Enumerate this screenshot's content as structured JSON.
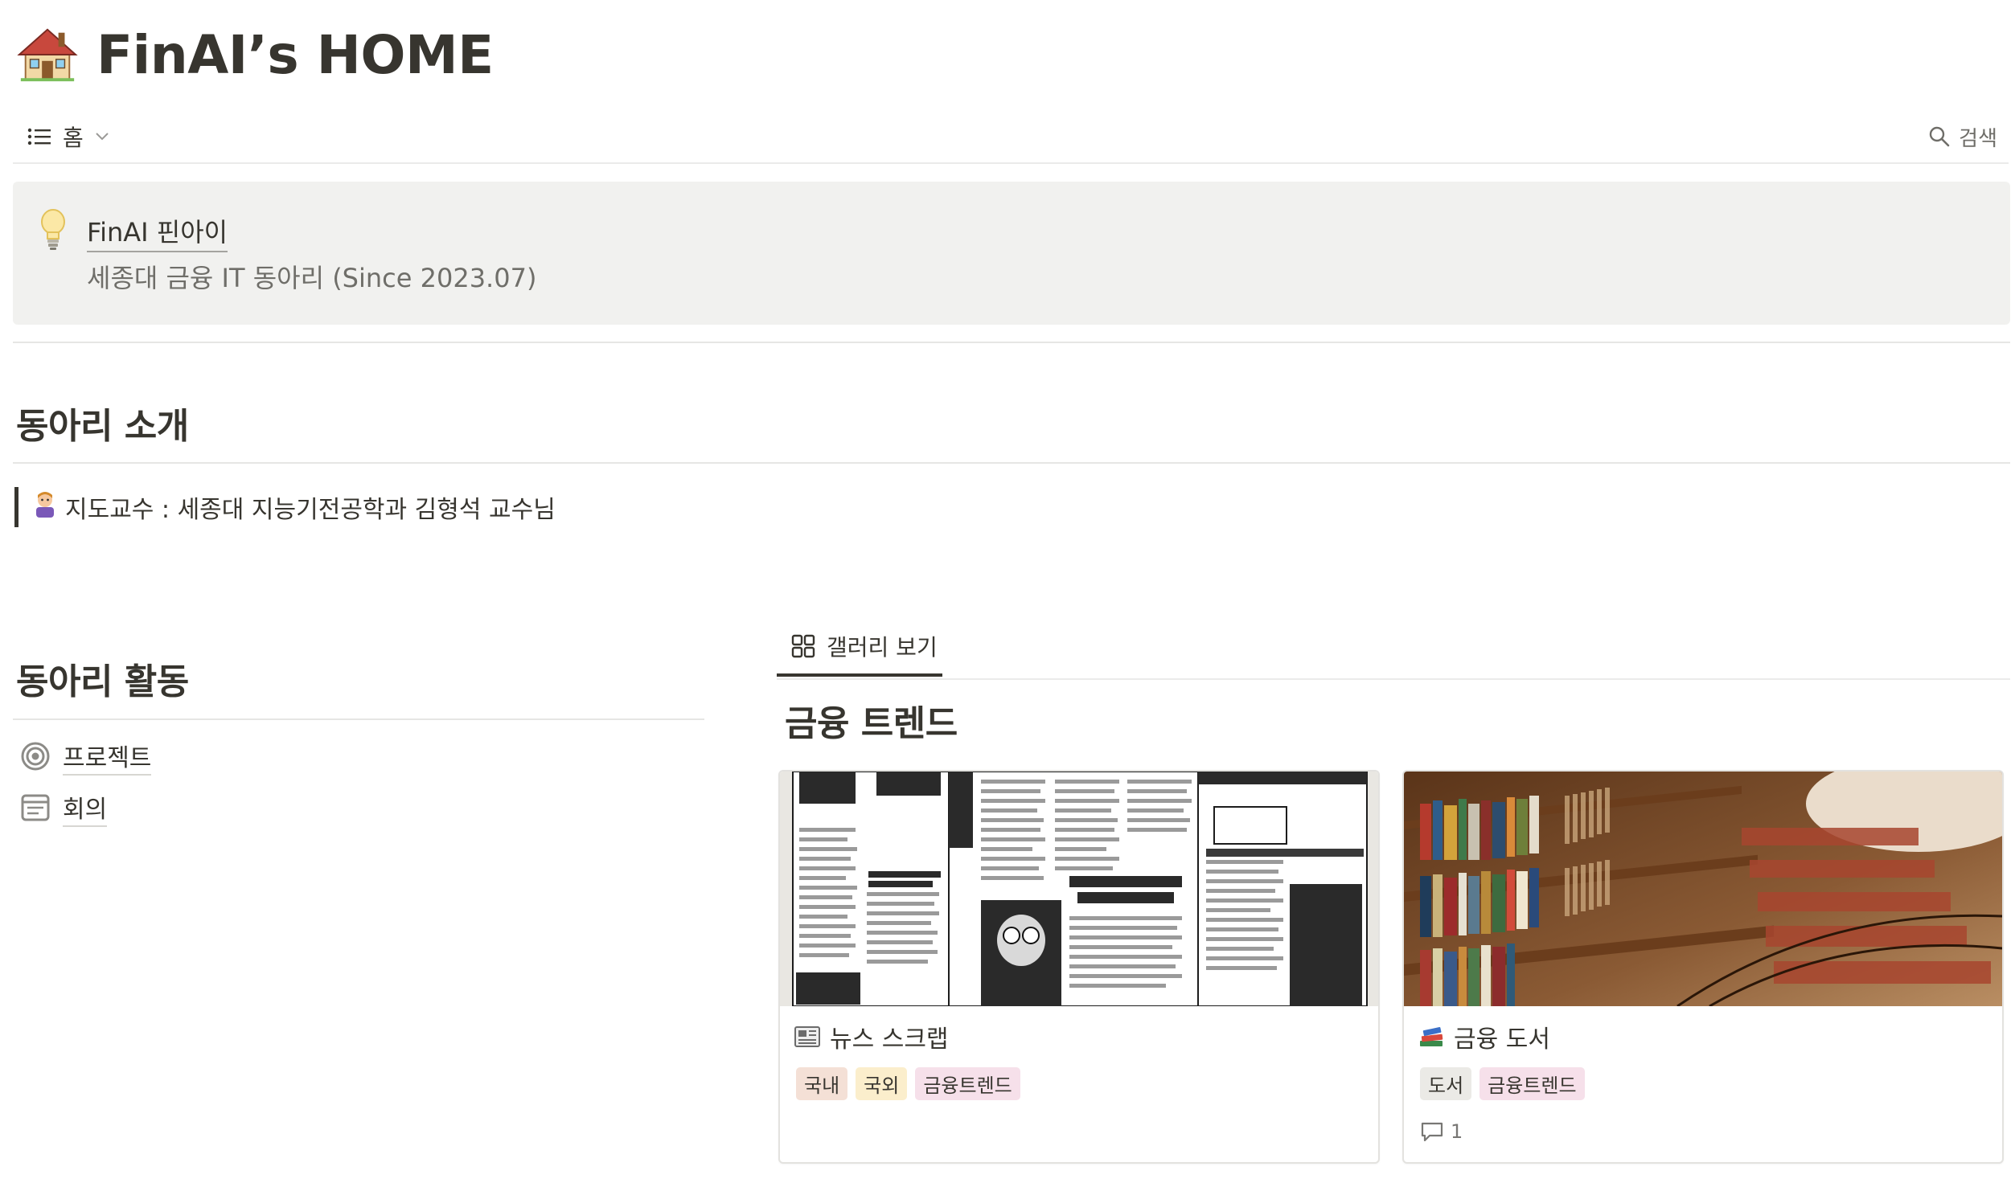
{
  "page": {
    "emoji_name": "house-icon",
    "title": "FinAI’s HOME"
  },
  "viewbar": {
    "view_label": "홈",
    "search_label": "검색"
  },
  "callout": {
    "title": "FinAI 핀아이",
    "subtitle": "세종대 금융 IT 동아리 (Since 2023.07)"
  },
  "intro": {
    "heading": "동아리 소개",
    "quote": "지도교수 : 세종대 지능기전공학과 김형석 교수님"
  },
  "activities": {
    "heading": "동아리 활동",
    "items": [
      {
        "label": "프로젝트",
        "icon": "target-icon"
      },
      {
        "label": "회의",
        "icon": "note-icon"
      }
    ]
  },
  "gallery": {
    "tab_label": "갤러리 보기",
    "heading": "금융 트렌드",
    "cards": [
      {
        "title": "뉴스 스크랩",
        "icon": "newspaper-icon",
        "tags": [
          {
            "label": "국내",
            "color": "#f4e0d6"
          },
          {
            "label": "국외",
            "color": "#fbeecc"
          },
          {
            "label": "금융트렌드",
            "color": "#f6e0ea"
          }
        ],
        "comments": null
      },
      {
        "title": "금융 도서",
        "icon": "books-icon",
        "tags": [
          {
            "label": "도서",
            "color": "#ebeae6"
          },
          {
            "label": "금융트렌드",
            "color": "#f6e0ea"
          }
        ],
        "comments": "1"
      }
    ]
  },
  "colors": {
    "text": "#37352f",
    "muted": "#6f6e69",
    "callout_bg": "#f1f1ef"
  }
}
